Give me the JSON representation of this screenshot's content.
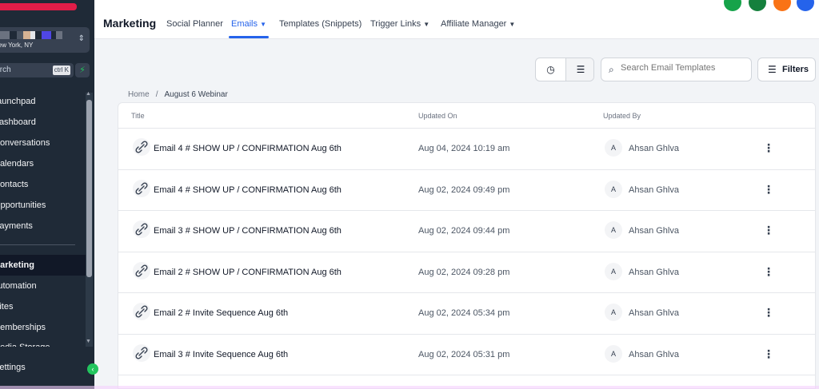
{
  "sidebar": {
    "location": "New York, NY",
    "search_placeholder": "Search",
    "search_shortcut": "ctrl K",
    "items": [
      {
        "label": "Launchpad"
      },
      {
        "label": "Dashboard"
      },
      {
        "label": "Conversations"
      },
      {
        "label": "Calendars"
      },
      {
        "label": "Contacts"
      },
      {
        "label": "Opportunities"
      },
      {
        "label": "Payments"
      },
      {
        "label": "Marketing",
        "active": true
      },
      {
        "label": "Automation"
      },
      {
        "label": "Sites"
      },
      {
        "label": "Memberships"
      },
      {
        "label": "Media Storage"
      }
    ],
    "settings": "Settings"
  },
  "header": {
    "title": "Marketing",
    "tabs": [
      {
        "label": "Social Planner"
      },
      {
        "label": "Emails",
        "active": true
      },
      {
        "label": "Templates (Snippets)"
      },
      {
        "label": "Trigger Links"
      },
      {
        "label": "Affiliate Manager"
      }
    ]
  },
  "toolbar": {
    "search_placeholder": "Search Email Templates",
    "filters_label": "Filters"
  },
  "breadcrumb": {
    "home": "Home",
    "current": "August 6 Webinar"
  },
  "table": {
    "columns": [
      "Title",
      "Updated On",
      "Updated By"
    ],
    "rows": [
      {
        "title": "Email 4 # SHOW UP / CONFIRMATION Aug 6th",
        "updated_on": "Aug 04, 2024 10:19 am",
        "initial": "A",
        "updated_by": "Ahsan Ghlva"
      },
      {
        "title": "Email 4 # SHOW UP / CONFIRMATION Aug 6th",
        "updated_on": "Aug 02, 2024 09:49 pm",
        "initial": "A",
        "updated_by": "Ahsan Ghlva"
      },
      {
        "title": "Email 3 # SHOW UP / CONFIRMATION Aug 6th",
        "updated_on": "Aug 02, 2024 09:44 pm",
        "initial": "A",
        "updated_by": "Ahsan Ghlva"
      },
      {
        "title": "Email 2 # SHOW UP / CONFIRMATION Aug 6th",
        "updated_on": "Aug 02, 2024 09:28 pm",
        "initial": "A",
        "updated_by": "Ahsan Ghlva"
      },
      {
        "title": "Email 2 # Invite Sequence Aug 6th",
        "updated_on": "Aug 02, 2024 05:34 pm",
        "initial": "A",
        "updated_by": "Ahsan Ghlva"
      },
      {
        "title": "Email 3 # Invite Sequence Aug 6th",
        "updated_on": "Aug 02, 2024 05:31 pm",
        "initial": "A",
        "updated_by": "Ahsan Ghlva"
      }
    ]
  },
  "colors": {
    "accent": "#2563eb",
    "sidebar_bg": "#1f2a37",
    "status_green": "#22c55e"
  }
}
